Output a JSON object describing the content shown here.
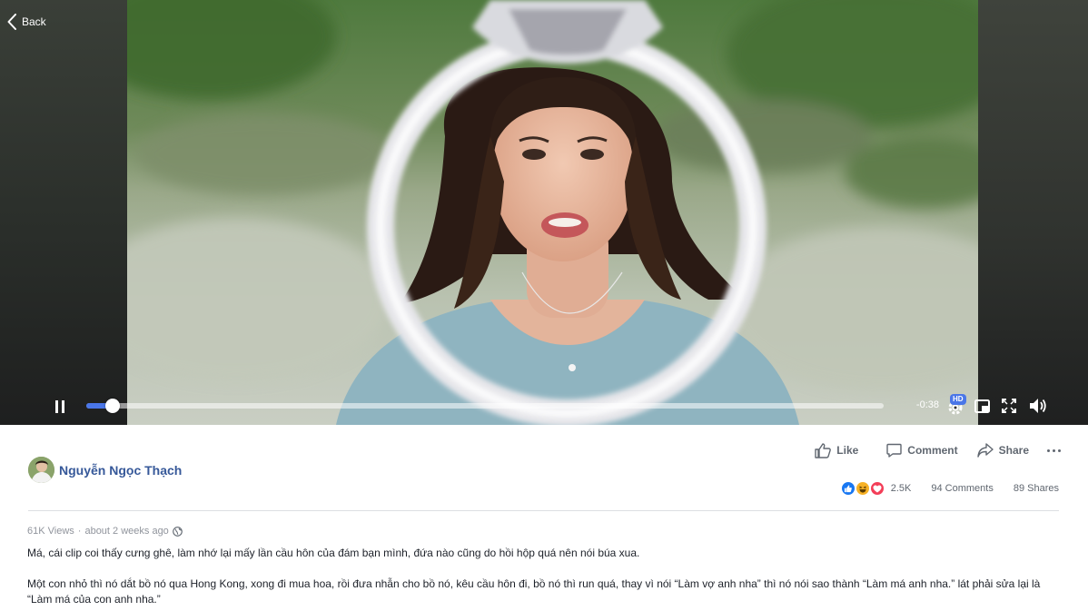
{
  "nav": {
    "back_label": "Back"
  },
  "player": {
    "time_remaining": "-0:38",
    "progress_fraction": 0.033,
    "quality_badge": "HD",
    "icons": [
      "back-chevron-icon",
      "pause-icon",
      "settings-gear-icon",
      "picture-in-picture-icon",
      "fullscreen-icon",
      "volume-icon"
    ]
  },
  "post": {
    "author_name": "Nguyễn Ngọc Thạch",
    "views": "61K Views",
    "separator": "·",
    "posted": "about 2 weeks ago",
    "caption_paragraphs": [
      "Má, cái clip coi thấy cưng ghê, làm nhớ lại mấy lần cầu hôn của đám bạn mình, đứa nào cũng do hồi hộp quá nên nói búa xua.",
      "Một con nhỏ thì nó dắt bồ nó qua Hong Kong, xong đi mua hoa, rồi đưa nhẫn cho bồ nó, kêu cầu hôn đi, bồ nó thì run quá, thay vì nói “Làm vợ anh nha” thì nó nói sao thành “Làm má anh nha.” lát phải sửa lại là “Làm má của con anh nha.”"
    ]
  },
  "actions": {
    "like_label": "Like",
    "comment_label": "Comment",
    "share_label": "Share"
  },
  "stats": {
    "reactions": [
      "like",
      "haha",
      "love"
    ],
    "reaction_count": "2.5K",
    "comments": "94 Comments",
    "shares": "89 Shares"
  },
  "colors": {
    "accent": "#4a76e8",
    "link": "#365899",
    "muted": "#606770"
  }
}
